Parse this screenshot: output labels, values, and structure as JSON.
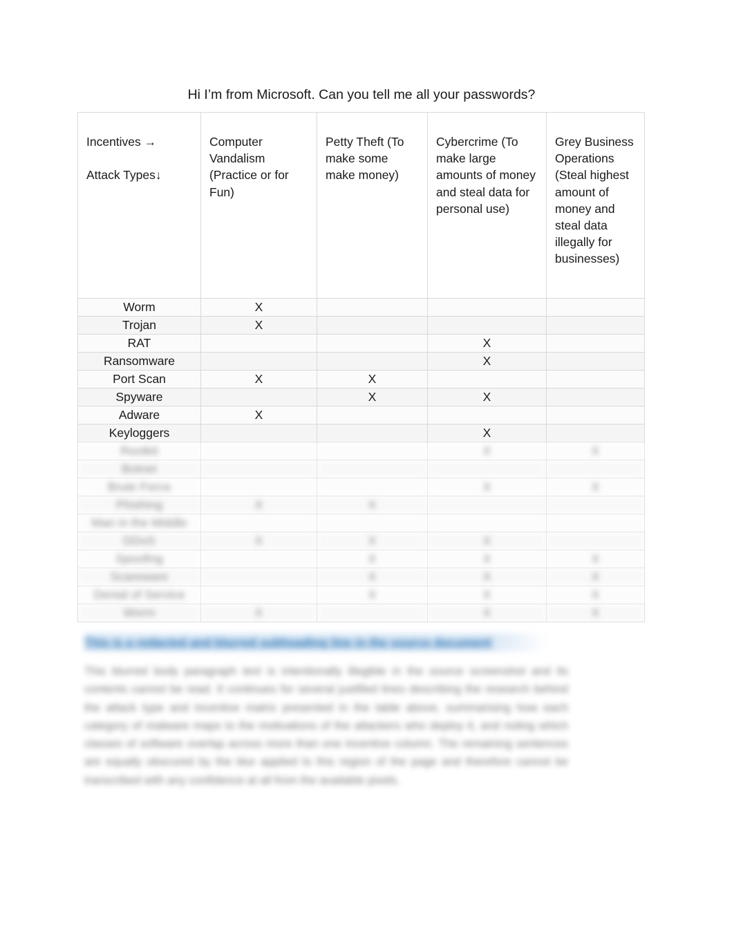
{
  "document": {
    "title": "Hi I’m from Microsoft. Can you tell me all your passwords?"
  },
  "matrix": {
    "header": {
      "corner_line1": "Incentives →",
      "corner_line2": "Attack Types↓",
      "columns": [
        "Computer Vandalism (Practice or for Fun)",
        "Petty Theft (To make some make money)",
        "Cybercrime (To make large amounts of money and steal data for personal use)",
        "Grey Business Operations (Steal highest amount of money and steal data illegally for businesses)"
      ]
    },
    "mark": "X",
    "rows": [
      {
        "label": "Worm",
        "marks": [
          "X",
          "",
          "",
          ""
        ],
        "blurred": false
      },
      {
        "label": "Trojan",
        "marks": [
          "X",
          "",
          "",
          ""
        ],
        "blurred": false
      },
      {
        "label": "RAT",
        "marks": [
          "",
          "",
          "X",
          ""
        ],
        "blurred": false
      },
      {
        "label": "Ransomware",
        "marks": [
          "",
          "",
          "X",
          ""
        ],
        "blurred": false
      },
      {
        "label": "Port Scan",
        "marks": [
          "X",
          "X",
          "",
          ""
        ],
        "blurred": false
      },
      {
        "label": "Spyware",
        "marks": [
          "",
          "X",
          "X",
          ""
        ],
        "blurred": false
      },
      {
        "label": "Adware",
        "marks": [
          "X",
          "",
          "",
          ""
        ],
        "blurred": false
      },
      {
        "label": "Keyloggers",
        "marks": [
          "",
          "",
          "X",
          ""
        ],
        "blurred": false
      },
      {
        "label": "Rootkit",
        "marks": [
          "",
          "",
          "X",
          "X"
        ],
        "blurred": true
      },
      {
        "label": "Botnet",
        "marks": [
          "",
          "",
          "",
          ""
        ],
        "blurred": true
      },
      {
        "label": "Brute Force",
        "marks": [
          "",
          "",
          "X",
          "X"
        ],
        "blurred": true
      },
      {
        "label": "Phishing",
        "marks": [
          "X",
          "X",
          "",
          ""
        ],
        "blurred": true
      },
      {
        "label": "Man in the Middle",
        "marks": [
          "",
          "",
          "",
          ""
        ],
        "blurred": true
      },
      {
        "label": "DDoS",
        "marks": [
          "X",
          "X",
          "X",
          ""
        ],
        "blurred": true
      },
      {
        "label": "Spoofing",
        "marks": [
          "",
          "X",
          "X",
          "X"
        ],
        "blurred": true
      },
      {
        "label": "Scareware",
        "marks": [
          "",
          "X",
          "X",
          "X"
        ],
        "blurred": true
      },
      {
        "label": "Denial of Service",
        "marks": [
          "",
          "X",
          "X",
          "X"
        ],
        "blurred": true
      },
      {
        "label": "Worm",
        "marks": [
          "X",
          "",
          "X",
          "X"
        ],
        "blurred": true
      }
    ]
  },
  "redacted": {
    "heading": "This is a redacted and blurred subheading line in the source document",
    "paragraph": "This blurred body paragraph text is intentionally illegible in the source screenshot and its contents cannot be read. It continues for several justified lines describing the research behind the attack type and incentive matrix presented in the table above, summarising how each category of malware maps to the motivations of the attackers who deploy it, and noting which classes of software overlap across more than one incentive column. The remaining sentences are equally obscured by the blur applied to this region of the page and therefore cannot be transcribed with any confidence at all from the available pixels."
  }
}
